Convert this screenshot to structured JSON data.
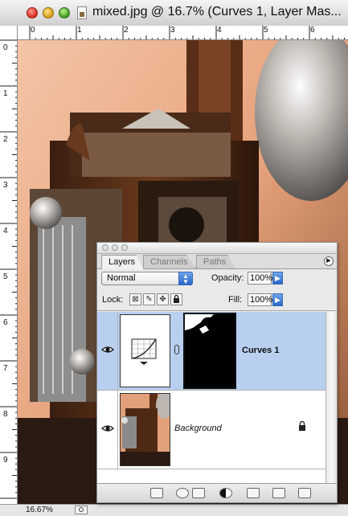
{
  "window": {
    "title": "mixed.jpg @ 16.7% (Curves 1, Layer Mas..."
  },
  "rulers": {
    "top": [
      "0",
      "1",
      "2",
      "3",
      "4",
      "5",
      "6"
    ],
    "left": [
      "0",
      "1",
      "2",
      "3",
      "4",
      "5",
      "6",
      "7",
      "8",
      "9"
    ]
  },
  "status": {
    "zoom": "16.67%"
  },
  "layers_panel": {
    "tabs": [
      {
        "label": "Layers",
        "active": true
      },
      {
        "label": "Channels",
        "active": false
      },
      {
        "label": "Paths",
        "active": false
      }
    ],
    "blend_mode": "Normal",
    "opacity_label": "Opacity:",
    "opacity_value": "100%",
    "lock_label": "Lock:",
    "fill_label": "Fill:",
    "fill_value": "100%",
    "layers": [
      {
        "name": "Curves 1",
        "selected": true,
        "visible": true
      },
      {
        "name": "Background",
        "selected": false,
        "visible": true,
        "locked": true
      }
    ]
  },
  "colors": {
    "selection": "#b8cff0",
    "accent_button": "#2a66c7"
  }
}
